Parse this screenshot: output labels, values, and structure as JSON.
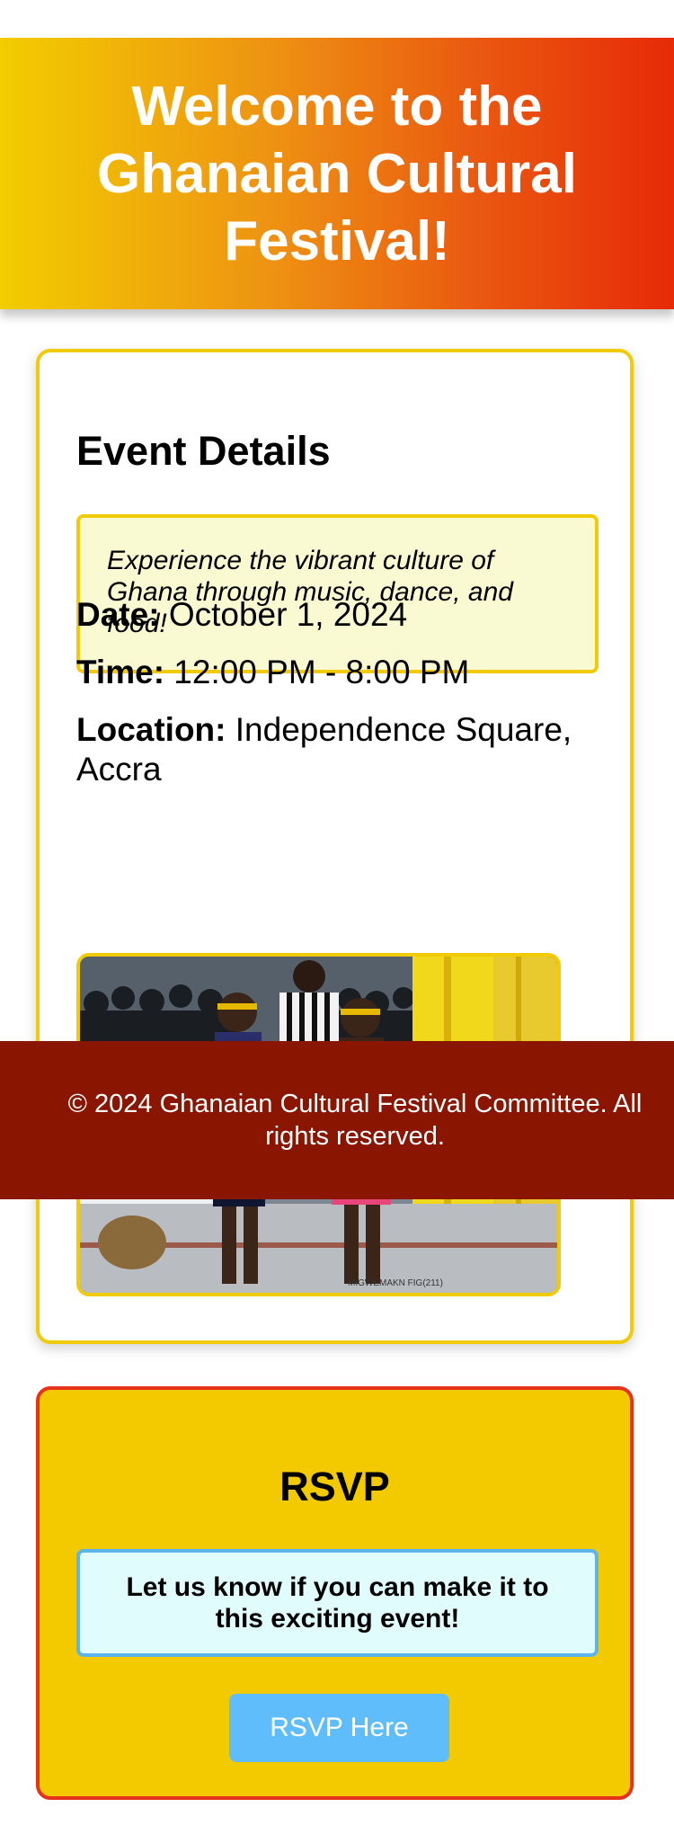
{
  "header": {
    "title": "Welcome to the Ghanaian Cultural Festival!"
  },
  "event": {
    "heading": "Event Details",
    "tagline": "Experience the vibrant culture of Ghana through music, dance, and food!",
    "date_label": "Date:",
    "date_value": "October 1, 2024",
    "time_label": "Time:",
    "time_value": "12:00 PM - 8:00 PM",
    "location_label": "Location:",
    "location_value": "Independence Square, Accra",
    "photo_watermark": "MIGWEMAKN FIG(211)",
    "photo_subject": "cultural-dancers-photo"
  },
  "rsvp": {
    "heading": "RSVP",
    "message": "Let us know if you can make it to this exciting event!",
    "button_label": "RSVP Here"
  },
  "footer": {
    "text": "© 2024 Ghanaian Cultural Festival Committee. All rights reserved."
  },
  "colors": {
    "gradient_start": "#f2cd00",
    "gradient_end": "#e72a08",
    "card_border": "#f2cb08",
    "tagline_bg": "#fafad2",
    "rsvp_bg": "#f3ca00",
    "rsvp_border": "#e4321b",
    "message_bg": "#e0fcfd",
    "message_border": "#5bb4ec",
    "button_bg": "#60bdfb",
    "footer_bg": "#8a1602"
  }
}
